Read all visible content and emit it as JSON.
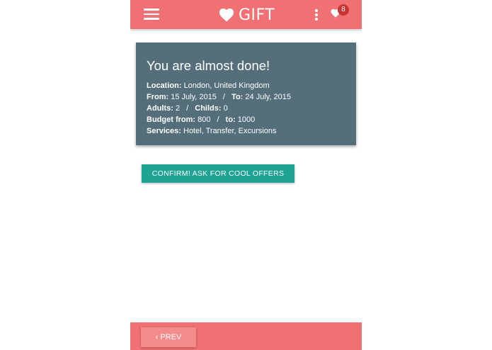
{
  "header": {
    "brand": "GIFT",
    "favorites_count": "8",
    "icons": {
      "menu": "hamburger-icon",
      "brand": "heart-icon",
      "more": "vertical-dots-icon",
      "favorites": "heart-icon"
    }
  },
  "summary": {
    "title": "You are almost done!",
    "location_label": "Location:",
    "location_value": "London, United Kingdom",
    "from_label": "From:",
    "from_value": "15 July, 2015",
    "to_label": "To:",
    "to_value": "24 July, 2015",
    "adults_label": "Adults:",
    "adults_value": "2",
    "childs_label": "Childs:",
    "childs_value": "0",
    "budget_from_label": "Budget from:",
    "budget_from_value": "800",
    "budget_to_label": "to:",
    "budget_to_value": "1000",
    "services_label": "Services:",
    "services_value": "Hotel, Transfer, Excursions",
    "separator": "/"
  },
  "actions": {
    "confirm_label": "CONFIRM! ASK FOR COOL OFFERS",
    "prev_label": "PREV",
    "prev_icon": "‹"
  },
  "colors": {
    "primary": "#f07073",
    "card": "#546e7a",
    "accent": "#1fa394",
    "badge": "#c8342f"
  }
}
